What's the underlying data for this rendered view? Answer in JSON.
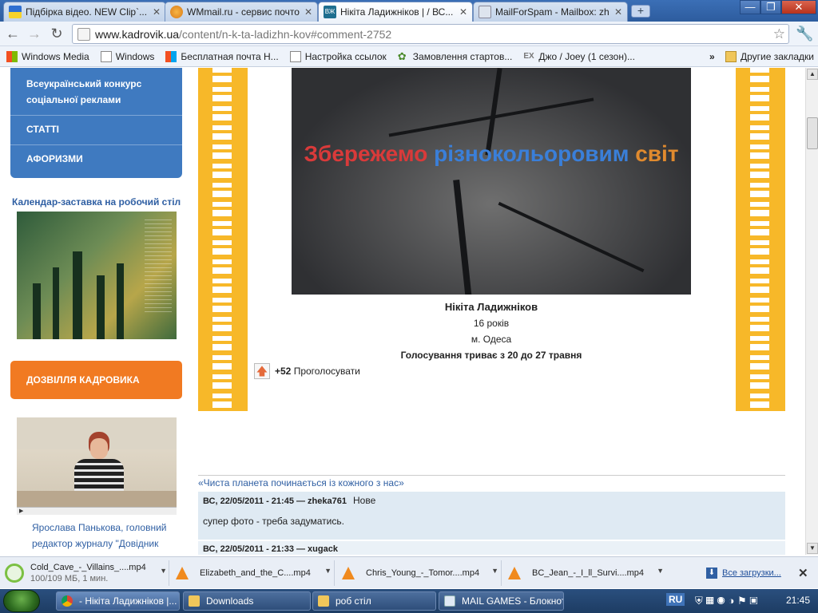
{
  "browser": {
    "tabs": [
      {
        "title": "Підбірка відео. NEW Clip`...",
        "active": false
      },
      {
        "title": "WMmail.ru - сервис почто...",
        "active": false
      },
      {
        "title": "Нікіта Ладижніков | / ВС...",
        "active": true
      },
      {
        "title": "MailForSpam - Mailbox: zhe...",
        "active": false
      }
    ],
    "new_tab": "+",
    "address": {
      "host": "www.kadrovik.ua",
      "path": "/content/n-k-ta-ladizhn-kov#comment-2752"
    },
    "bookmarks": [
      "Windows Media",
      "Windows",
      "Бесплатная почта Н...",
      "Настройка ссылок",
      "Замовлення стартов...",
      "Джо / Joey (1 сезон)..."
    ],
    "more_bookmarks": "»",
    "other_bookmarks": "Другие закладки"
  },
  "sidebar": {
    "menu": [
      "Всеукраїнський конкурс соціальної реклами",
      "СТАТТІ",
      "АФОРИЗМИ"
    ],
    "calendar_title": "Календар-заставка на робочий стіл",
    "leisure_button": "ДОЗВІЛЛЯ КАДРОВИКА",
    "video_caption": "Ярослава Панькова, головний редактор журналу \"Довідник"
  },
  "entry": {
    "slogan_parts": [
      {
        "text": "Збережемо ",
        "color": "#d93a3a"
      },
      {
        "text": "різнокольоровим ",
        "color": "#3a7fd9"
      },
      {
        "text": "світ",
        "color": "#e08a2e"
      }
    ],
    "name": "Нікіта Ладижніков",
    "age": "16 років",
    "city": "м. Одеса",
    "voting": "Голосування триває з 20 до 27 травня",
    "vote_count": "+52",
    "vote_label": "Проголосувати"
  },
  "comments": {
    "link": "«Чиста планета починається із кожного з нас»",
    "items": [
      {
        "meta": "ВС, 22/05/2011 - 21:45 — zheka761",
        "badge": "Нове",
        "text": "супер фото - треба задуматись."
      },
      {
        "meta": "ВС, 22/05/2011 - 21:33 — xugack",
        "badge": "",
        "text": ""
      }
    ]
  },
  "downloads": {
    "items": [
      {
        "name": "Cold_Cave_-_Villains_....mp4",
        "status": "100/109 МБ, 1 мин."
      },
      {
        "name": "Elizabeth_and_the_C....mp4",
        "status": ""
      },
      {
        "name": "Chris_Young_-_Tomor....mp4",
        "status": ""
      },
      {
        "name": "BC_Jean_-_I_ll_Survi....mp4",
        "status": ""
      }
    ],
    "all": "Все загрузки..."
  },
  "taskbar": {
    "items": [
      "- Нікіта Ладижніков |...",
      "Downloads",
      "роб стіл",
      "MAIL GAMES - Блокнот"
    ],
    "lang": "RU",
    "clock": "21:45"
  }
}
